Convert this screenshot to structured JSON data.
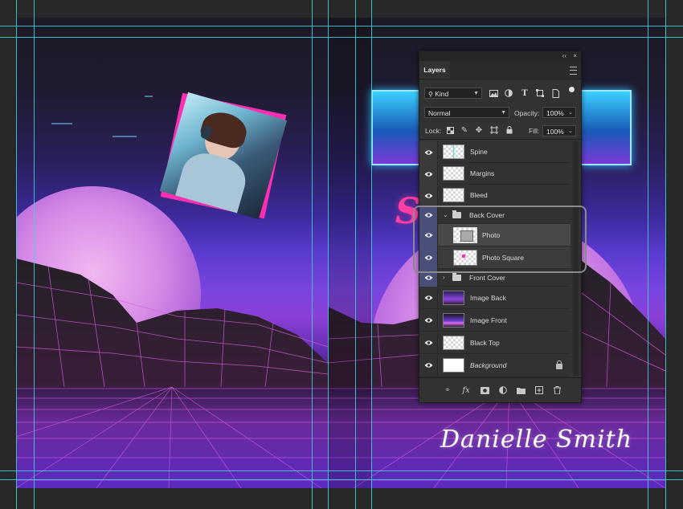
{
  "artwork": {
    "script_title": "Some",
    "author": "Danielle Smith"
  },
  "layers_panel": {
    "tab_label": "Layers",
    "collapse_glyph": "‹‹",
    "close_glyph": "×",
    "filter_kind": "Kind",
    "blend_mode": "Normal",
    "opacity_label": "Opacity:",
    "opacity_value": "100%",
    "lock_label": "Lock:",
    "fill_label": "Fill:",
    "fill_value": "100%",
    "layers": [
      {
        "name": "Spine",
        "type": "layer",
        "visible": true
      },
      {
        "name": "Margins",
        "type": "layer",
        "visible": true
      },
      {
        "name": "Bleed",
        "type": "layer",
        "visible": true
      },
      {
        "name": "Back Cover",
        "type": "group",
        "expanded": true,
        "visible": true
      },
      {
        "name": "Photo",
        "type": "layer",
        "visible": true,
        "selected": true
      },
      {
        "name": "Photo Square",
        "type": "layer",
        "visible": true,
        "selected": true
      },
      {
        "name": "Front Cover",
        "type": "group",
        "expanded": false,
        "visible": true
      },
      {
        "name": "Image Back",
        "type": "layer",
        "visible": true
      },
      {
        "name": "Image Front",
        "type": "layer",
        "visible": true
      },
      {
        "name": "Black Top",
        "type": "layer",
        "visible": true
      },
      {
        "name": "Background",
        "type": "background",
        "visible": true,
        "locked": true
      }
    ]
  },
  "colors": {
    "guide": "#3fd4dc",
    "accent_pink": "#ff2fb4",
    "panel_bg": "#323232"
  }
}
